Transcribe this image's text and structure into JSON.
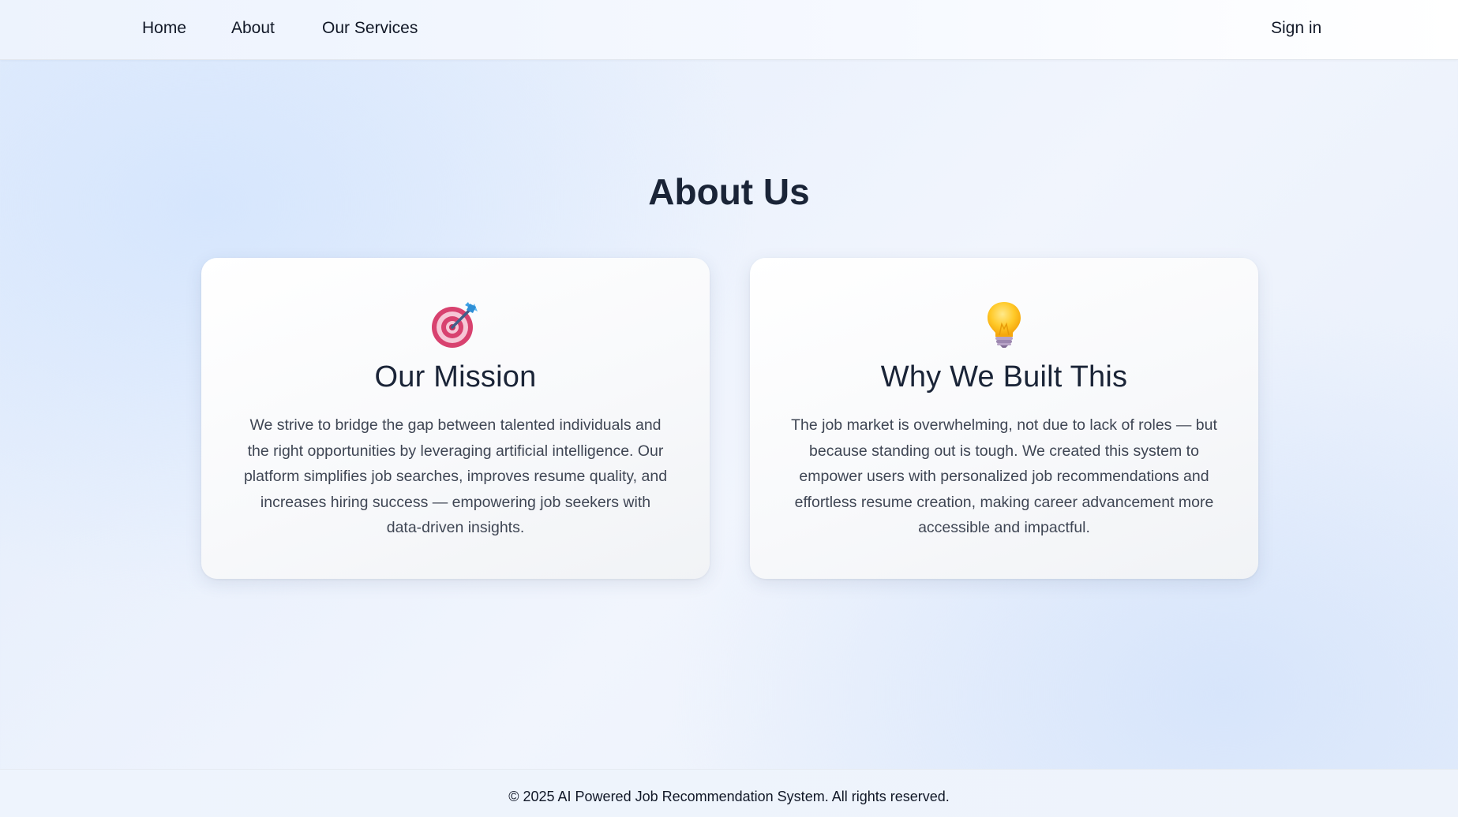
{
  "nav": {
    "home": "Home",
    "about": "About",
    "services": "Our Services",
    "signin": "Sign in"
  },
  "page": {
    "title": "About Us"
  },
  "cards": [
    {
      "icon": "target-dart-icon",
      "title": "Our Mission",
      "text": "We strive to bridge the gap between talented individuals and the right opportunities by leveraging artificial intelligence. Our platform simplifies job searches, improves resume quality, and increases hiring success — empowering job seekers with data-driven insights."
    },
    {
      "icon": "lightbulb-icon",
      "title": "Why We Built This",
      "text": "The job market is overwhelming, not due to lack of roles — but because standing out is tough. We created this system to empower users with personalized job recommendations and effortless resume creation, making career advancement more accessible and impactful."
    }
  ],
  "footer": {
    "text": "© 2025 AI Powered Job Recommendation System. All rights reserved."
  },
  "colors": {
    "heading": "#1a2437",
    "body_text": "#3f4654",
    "nav_text": "#111827"
  }
}
